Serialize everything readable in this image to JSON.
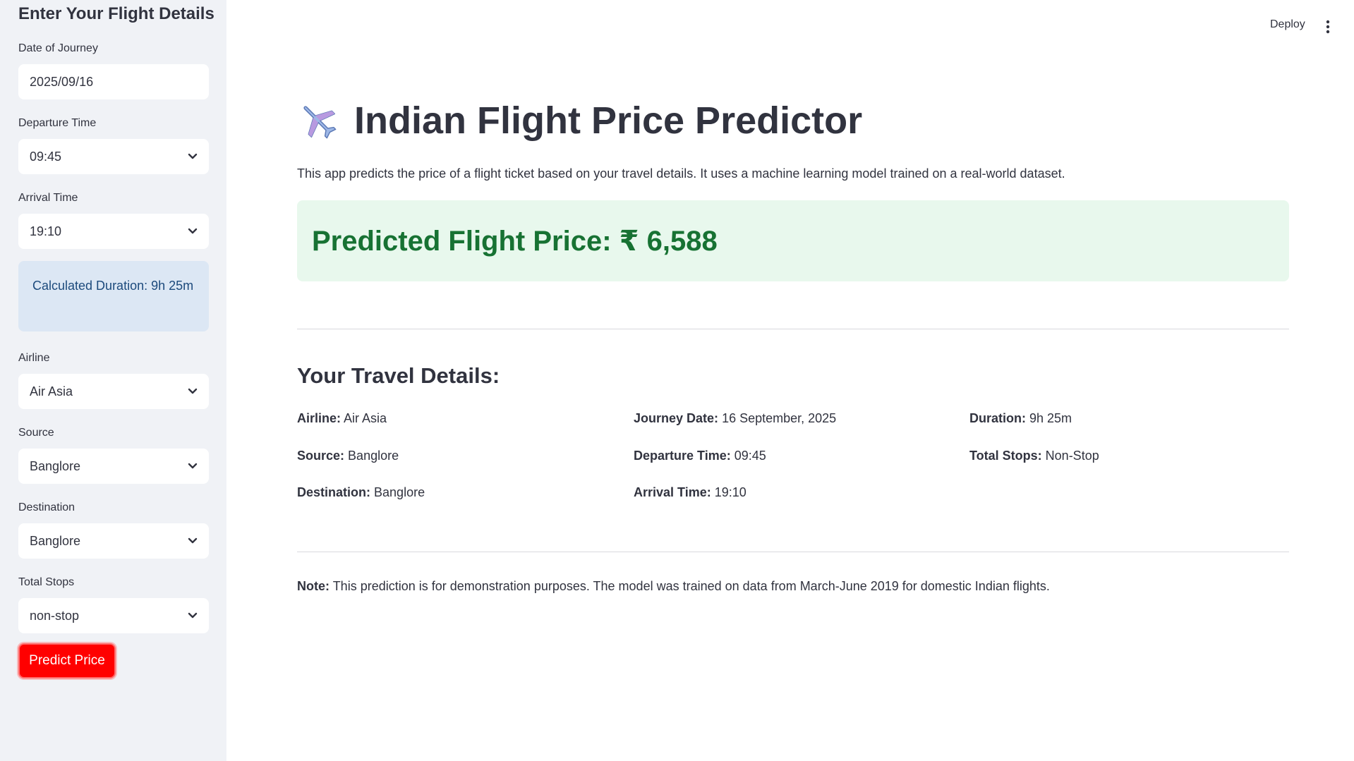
{
  "sidebar": {
    "title": "Enter Your Flight Details",
    "date": {
      "label": "Date of Journey",
      "value": "2025/09/16"
    },
    "departure": {
      "label": "Departure Time",
      "value": "09:45"
    },
    "arrival": {
      "label": "Arrival Time",
      "value": "19:10"
    },
    "duration_info": "Calculated Duration: 9h 25m",
    "airline": {
      "label": "Airline",
      "value": "Air Asia"
    },
    "source": {
      "label": "Source",
      "value": "Banglore"
    },
    "destination": {
      "label": "Destination",
      "value": "Banglore"
    },
    "stops": {
      "label": "Total Stops",
      "value": "non-stop"
    },
    "predict_label": "Predict Price"
  },
  "header": {
    "deploy_label": "Deploy",
    "menu_icon": "kebab-menu-icon"
  },
  "main": {
    "title_icon": "airplane-icon",
    "title": "Indian Flight Price Predictor",
    "description": "This app predicts the price of a flight ticket based on your travel details. It uses a machine learning model trained on a real-world dataset.",
    "prediction": "Predicted Flight Price: ₹ 6,588",
    "details_title": "Your Travel Details:",
    "details": {
      "airline": {
        "label": "Airline:",
        "value": "Air Asia"
      },
      "source": {
        "label": "Source:",
        "value": "Banglore"
      },
      "destination": {
        "label": "Destination:",
        "value": "Banglore"
      },
      "journey_date": {
        "label": "Journey Date:",
        "value": "16 September, 2025"
      },
      "departure_time": {
        "label": "Departure Time:",
        "value": "09:45"
      },
      "arrival_time": {
        "label": "Arrival Time:",
        "value": "19:10"
      },
      "duration": {
        "label": "Duration:",
        "value": "9h 25m"
      },
      "total_stops": {
        "label": "Total Stops:",
        "value": "Non-Stop"
      }
    },
    "note_label": "Note:",
    "note_text": "This prediction is for demonstration purposes. The model was trained on data from March-June 2019 for domestic Indian flights."
  },
  "colors": {
    "sidebar_bg": "#f0f2f6",
    "success_bg": "#e8f8ed",
    "success_text": "#177233",
    "info_bg": "#dce7f4",
    "info_text": "#1c4a7c",
    "primary_button": "#ff0000"
  }
}
